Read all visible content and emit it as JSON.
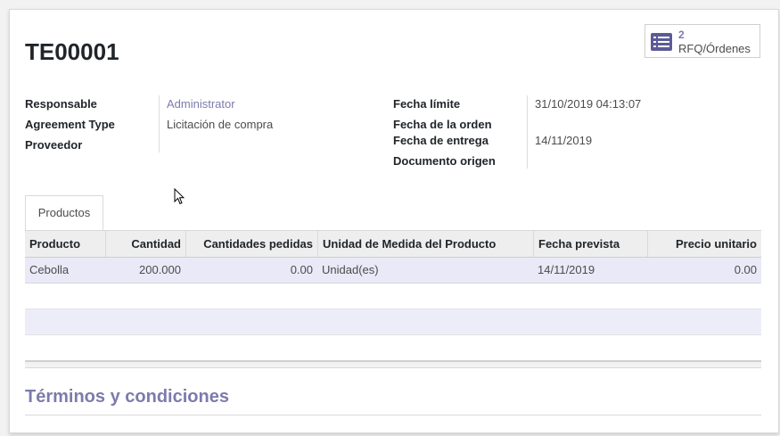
{
  "smart_button": {
    "count": "2",
    "label": "RFQ/Órdenes",
    "icon": "list-icon"
  },
  "record": {
    "title": "TE00001"
  },
  "fields_left": {
    "responsable_label": "Responsable",
    "responsable_value": "Administrator",
    "agreement_type_label": "Agreement Type",
    "agreement_type_value": "Licitación de compra",
    "proveedor_label": "Proveedor",
    "proveedor_value": ""
  },
  "fields_right": {
    "fecha_limite_label": "Fecha límite",
    "fecha_limite_value": "31/10/2019 04:13:07",
    "fecha_orden_label": "Fecha de la orden",
    "fecha_orden_value": "",
    "fecha_entrega_label": "Fecha de entrega",
    "fecha_entrega_value": "14/11/2019",
    "documento_origen_label": "Documento origen",
    "documento_origen_value": ""
  },
  "tabs": [
    {
      "label": "Productos",
      "active": true
    }
  ],
  "table": {
    "columns": [
      "Producto",
      "Cantidad",
      "Cantidades pedidas",
      "Unidad de Medida del Producto",
      "Fecha prevista",
      "Precio unitario"
    ],
    "rows": [
      [
        "Cebolla",
        "200.000",
        "0.00",
        "Unidad(es)",
        "14/11/2019",
        "0.00"
      ]
    ]
  },
  "terms_title": "Términos y condiciones",
  "colors": {
    "accent": "#7c7bad",
    "row_highlight": "#e9e9f7",
    "header_bg": "#eeeeee"
  }
}
